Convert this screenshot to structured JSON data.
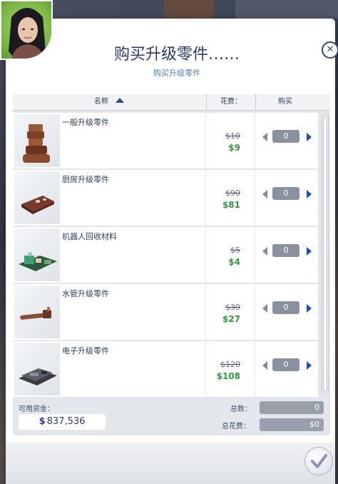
{
  "dialog": {
    "title": "购买升级零件……",
    "subtitle": "购买升级零件",
    "close_icon": "close-icon"
  },
  "table": {
    "columns": {
      "name": "名称",
      "cost": "花费：",
      "buy": "购买"
    },
    "sort": "ascending",
    "rows": [
      {
        "name": "一般升级零件",
        "old_price": "10",
        "price": "9",
        "qty": "0",
        "icon": "general-parts-icon"
      },
      {
        "name": "厨房升级零件",
        "old_price": "90",
        "price": "81",
        "qty": "0",
        "icon": "kitchen-parts-icon"
      },
      {
        "name": "机器人回收材料",
        "old_price": "5",
        "price": "4",
        "qty": "0",
        "icon": "robot-salvage-icon"
      },
      {
        "name": "水管升级零件",
        "old_price": "30",
        "price": "27",
        "qty": "0",
        "icon": "plumbing-parts-icon"
      },
      {
        "name": "电子升级零件",
        "old_price": "120",
        "price": "108",
        "qty": "0",
        "icon": "electronics-parts-icon"
      }
    ]
  },
  "currency_symbol": "$",
  "footer": {
    "funds_label": "可用资金：",
    "funds_value": "837,536",
    "total_count_label": "总数：",
    "total_count_value": "0",
    "total_cost_label": "总花费：",
    "total_cost_value": "0"
  },
  "colors": {
    "title": "#2a3b6e",
    "discount_price": "#2f9a3c",
    "accent_blue": "#1f4fb5"
  }
}
